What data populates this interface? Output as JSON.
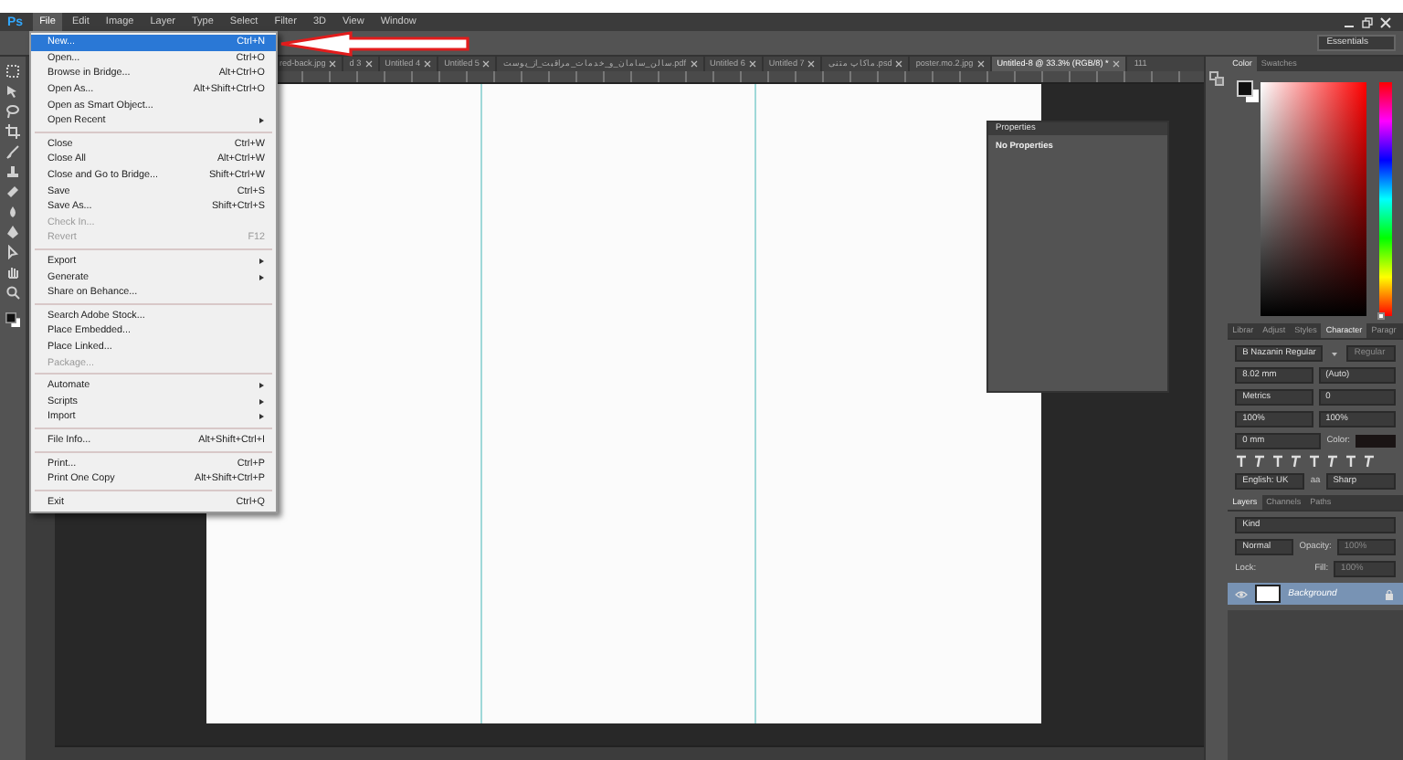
{
  "menu_bar": {
    "app_logo": "Ps",
    "items": [
      {
        "label": "File",
        "selected": true
      },
      {
        "label": "Edit",
        "selected": false
      },
      {
        "label": "Image",
        "selected": false
      },
      {
        "label": "Layer",
        "selected": false
      },
      {
        "label": "Type",
        "selected": false
      },
      {
        "label": "Select",
        "selected": false
      },
      {
        "label": "Filter",
        "selected": false
      },
      {
        "label": "3D",
        "selected": false
      },
      {
        "label": "View",
        "selected": false
      },
      {
        "label": "Window",
        "selected": false
      }
    ]
  },
  "options_bar": {
    "workspace": "Essentials"
  },
  "file_menu": {
    "groups": [
      [
        {
          "label": "New...",
          "shortcut": "Ctrl+N",
          "selected": true,
          "disabled": false,
          "submenu": false
        },
        {
          "label": "Open...",
          "shortcut": "Ctrl+O",
          "selected": false,
          "disabled": false,
          "submenu": false
        },
        {
          "label": "Browse in Bridge...",
          "shortcut": "Alt+Ctrl+O",
          "selected": false,
          "disabled": false,
          "submenu": false
        },
        {
          "label": "Open As...",
          "shortcut": "Alt+Shift+Ctrl+O",
          "selected": false,
          "disabled": false,
          "submenu": false
        },
        {
          "label": "Open as Smart Object...",
          "selected": false,
          "disabled": false,
          "submenu": false
        },
        {
          "label": "Open Recent",
          "selected": false,
          "disabled": false,
          "submenu": true
        }
      ],
      [
        {
          "label": "Close",
          "shortcut": "Ctrl+W",
          "selected": false,
          "disabled": false,
          "submenu": false
        },
        {
          "label": "Close All",
          "shortcut": "Alt+Ctrl+W",
          "selected": false,
          "disabled": false,
          "submenu": false
        },
        {
          "label": "Close and Go to Bridge...",
          "shortcut": "Shift+Ctrl+W",
          "selected": false,
          "disabled": false,
          "submenu": false
        },
        {
          "label": "Save",
          "shortcut": "Ctrl+S",
          "selected": false,
          "disabled": false,
          "submenu": false
        },
        {
          "label": "Save As...",
          "shortcut": "Shift+Ctrl+S",
          "selected": false,
          "disabled": false,
          "submenu": false
        },
        {
          "label": "Check In...",
          "selected": false,
          "disabled": true,
          "submenu": false
        },
        {
          "label": "Revert",
          "shortcut": "F12",
          "selected": false,
          "disabled": true,
          "submenu": false
        }
      ],
      [
        {
          "label": "Export",
          "selected": false,
          "disabled": false,
          "submenu": true
        },
        {
          "label": "Generate",
          "selected": false,
          "disabled": false,
          "submenu": true
        },
        {
          "label": "Share on Behance...",
          "selected": false,
          "disabled": false,
          "submenu": false
        }
      ],
      [
        {
          "label": "Search Adobe Stock...",
          "selected": false,
          "disabled": false,
          "submenu": false
        },
        {
          "label": "Place Embedded...",
          "selected": false,
          "disabled": false,
          "submenu": false
        },
        {
          "label": "Place Linked...",
          "selected": false,
          "disabled": false,
          "submenu": false
        },
        {
          "label": "Package...",
          "selected": false,
          "disabled": true,
          "submenu": false
        }
      ],
      [
        {
          "label": "Automate",
          "selected": false,
          "disabled": false,
          "submenu": true
        },
        {
          "label": "Scripts",
          "selected": false,
          "disabled": false,
          "submenu": true
        },
        {
          "label": "Import",
          "selected": false,
          "disabled": false,
          "submenu": true
        }
      ],
      [
        {
          "label": "File Info...",
          "shortcut": "Alt+Shift+Ctrl+I",
          "selected": false,
          "disabled": false,
          "submenu": false
        }
      ],
      [
        {
          "label": "Print...",
          "shortcut": "Ctrl+P",
          "selected": false,
          "disabled": false,
          "submenu": false
        },
        {
          "label": "Print One Copy",
          "shortcut": "Alt+Shift+Ctrl+P",
          "selected": false,
          "disabled": false,
          "submenu": false
        }
      ],
      [
        {
          "label": "Exit",
          "shortcut": "Ctrl+Q",
          "selected": false,
          "disabled": false,
          "submenu": false
        }
      ]
    ]
  },
  "document_tabs": [
    {
      "label": "red-back.jpg",
      "selected": false
    },
    {
      "label": "d 3",
      "selected": false
    },
    {
      "label": "Untitled 4",
      "selected": false
    },
    {
      "label": "Untitled 5",
      "selected": false
    },
    {
      "label": "سالن_سامان_و_خدمات_مراقبت_از_پوست.pdf",
      "selected": false
    },
    {
      "label": "Untitled 6",
      "selected": false
    },
    {
      "label": "Untitled 7",
      "selected": false
    },
    {
      "label": "ماکاپ متنی.psd",
      "selected": false
    },
    {
      "label": "poster.mo.2.jpg",
      "selected": false
    },
    {
      "label": "Untitled-8 @ 33.3% (RGB/8) *",
      "selected": true
    }
  ],
  "tabs_overflow": "111",
  "properties_panel": {
    "title": "Properties",
    "message": "No Properties"
  },
  "color_panel": {
    "tabs": [
      {
        "label": "Color",
        "selected": true
      },
      {
        "label": "Swatches",
        "selected": false
      }
    ],
    "hue_slider": {
      "level": 0
    }
  },
  "character_panel": {
    "tabs": [
      {
        "label": "Librar",
        "selected": false
      },
      {
        "label": "Adjust",
        "selected": false
      },
      {
        "label": "Styles",
        "selected": false
      },
      {
        "label": "Character",
        "selected": true
      },
      {
        "label": "Paragr",
        "selected": false
      }
    ],
    "font_family": "B Nazanin Regular",
    "font_style": "Regular",
    "size": "8.02 mm",
    "leading": "(Auto)",
    "kerning": "Metrics",
    "tracking": "0",
    "vertical_scale": "100%",
    "horizontal_scale": "100%",
    "baseline_shift": "0 mm",
    "color_label": "Color:",
    "language": "English: UK",
    "antialias_label": "aa",
    "antialias": "Sharp"
  },
  "layers_panel": {
    "tabs": [
      {
        "label": "Layers",
        "selected": true
      },
      {
        "label": "Channels",
        "selected": false
      },
      {
        "label": "Paths",
        "selected": false
      }
    ],
    "filter": "Kind",
    "blend_mode": "Normal",
    "opacity_label": "Opacity:",
    "opacity": "100%",
    "lock_label": "Lock:",
    "fill_label": "Fill:",
    "fill": "100%",
    "layers": [
      {
        "name": "Background",
        "selected": true,
        "visible": true
      }
    ]
  }
}
